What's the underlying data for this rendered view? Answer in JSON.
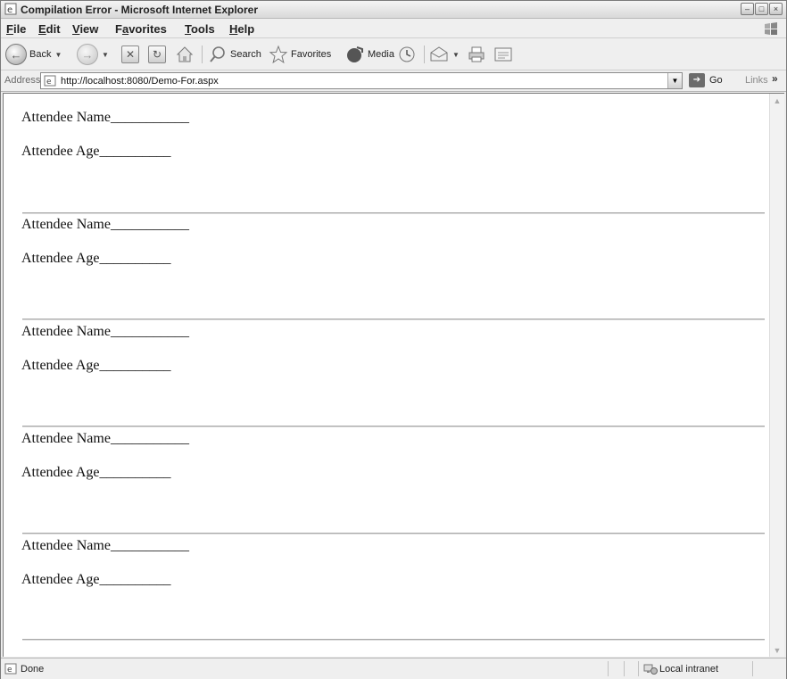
{
  "window": {
    "title": "Compilation Error - Microsoft Internet Explorer"
  },
  "menu": [
    {
      "label": "File",
      "key": "F",
      "rest": "ile"
    },
    {
      "label": "Edit",
      "key": "E",
      "rest": "dit"
    },
    {
      "label": "View",
      "key": "V",
      "rest": "iew"
    },
    {
      "label": "Favorites",
      "key": "a",
      "pre": "F",
      "rest": "vorites"
    },
    {
      "label": "Tools",
      "key": "T",
      "rest": "ools"
    },
    {
      "label": "Help",
      "key": "H",
      "rest": "elp"
    }
  ],
  "toolbar": {
    "back": "Back",
    "search": "Search",
    "favorites": "Favorites",
    "media": "Media"
  },
  "address": {
    "label": "Address",
    "url": "http://localhost:8080/Demo-For.aspx",
    "go": "Go",
    "links": "Links"
  },
  "attendees": [
    {
      "name_label": "Attendee Name___________",
      "age_label": "Attendee Age__________"
    },
    {
      "name_label": "Attendee Name___________",
      "age_label": "Attendee Age__________"
    },
    {
      "name_label": "Attendee Name___________",
      "age_label": "Attendee Age__________"
    },
    {
      "name_label": "Attendee Name___________",
      "age_label": "Attendee Age__________"
    },
    {
      "name_label": "Attendee Name___________",
      "age_label": "Attendee Age__________"
    }
  ],
  "status": {
    "text": "Done",
    "zone": "Local intranet"
  }
}
